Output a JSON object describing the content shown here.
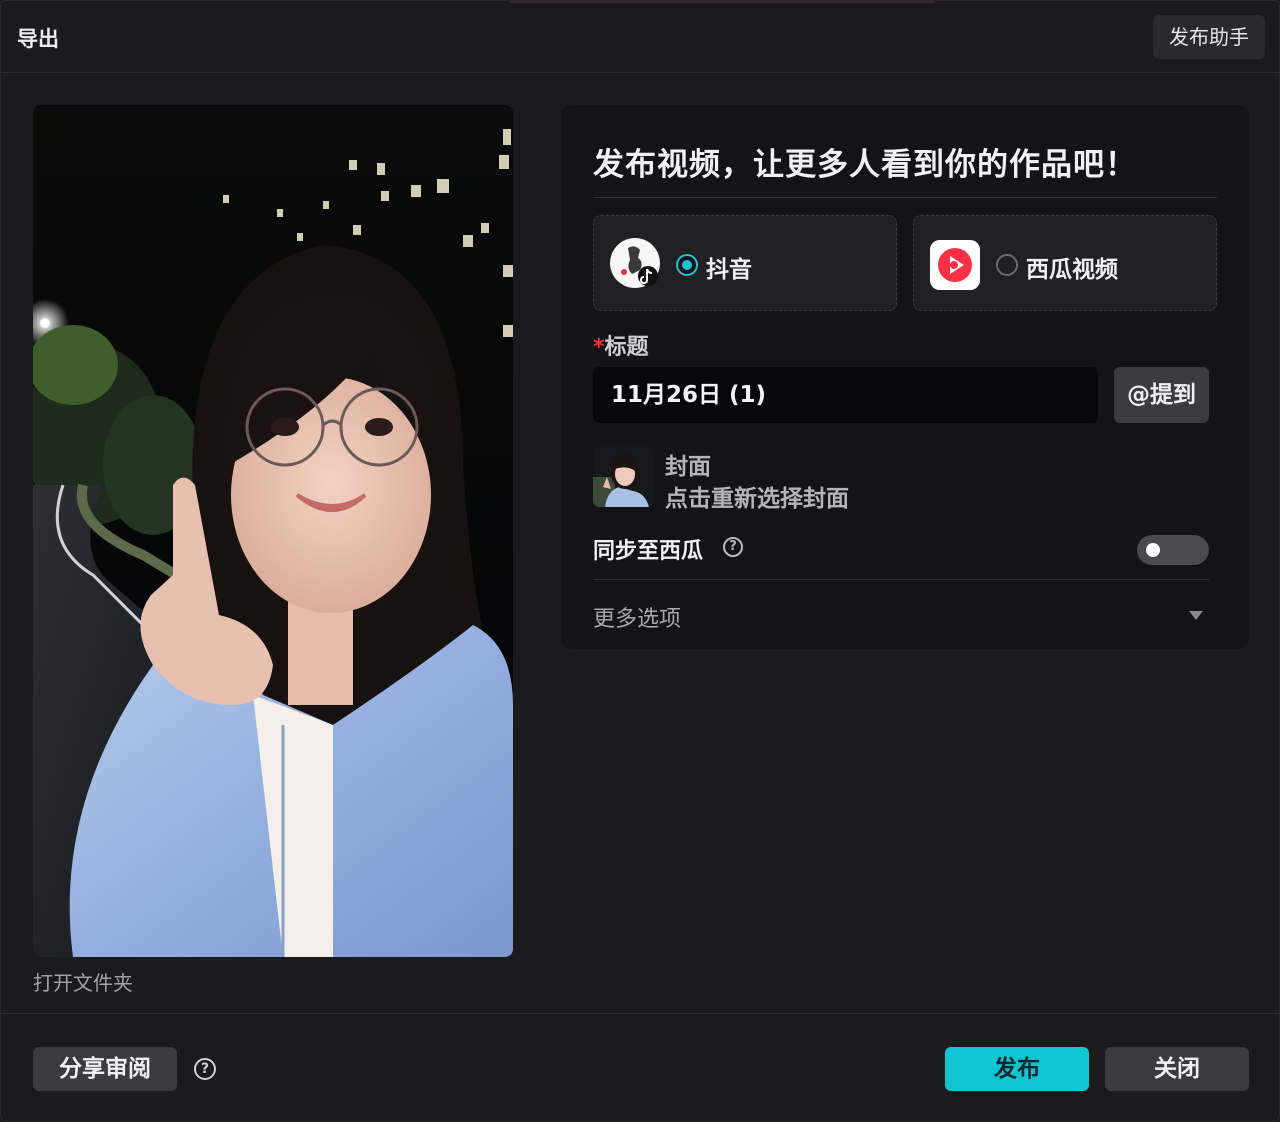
{
  "header": {
    "title": "导出",
    "assistant_label": "发布助手"
  },
  "preview": {
    "image": "video-preview-selfie",
    "open_folder_label": "打开文件夹"
  },
  "panel": {
    "heading": "发布视频，让更多人看到你的作品吧！",
    "platforms": [
      {
        "label": "抖音",
        "selected": true,
        "icon": "douyin-avatar-icon"
      },
      {
        "label": "西瓜视频",
        "selected": false,
        "icon": "xigua-logo-icon"
      }
    ],
    "title_field": {
      "required_mark": "*",
      "label": "标题",
      "value": "11月26日 (1)",
      "mention_label": "@提到"
    },
    "cover": {
      "title": "封面",
      "subtitle": "点击重新选择封面"
    },
    "sync": {
      "label": "同步至西瓜",
      "help_glyph": "?",
      "enabled": false
    },
    "more_options_label": "更多选项"
  },
  "footer": {
    "share_label": "分享审阅",
    "help_glyph": "?",
    "publish_label": "发布",
    "close_label": "关闭"
  },
  "colors": {
    "accent": "#10c4d2",
    "background": "#1b1b1d",
    "panel": "#141416",
    "required": "#ff2a3a"
  }
}
